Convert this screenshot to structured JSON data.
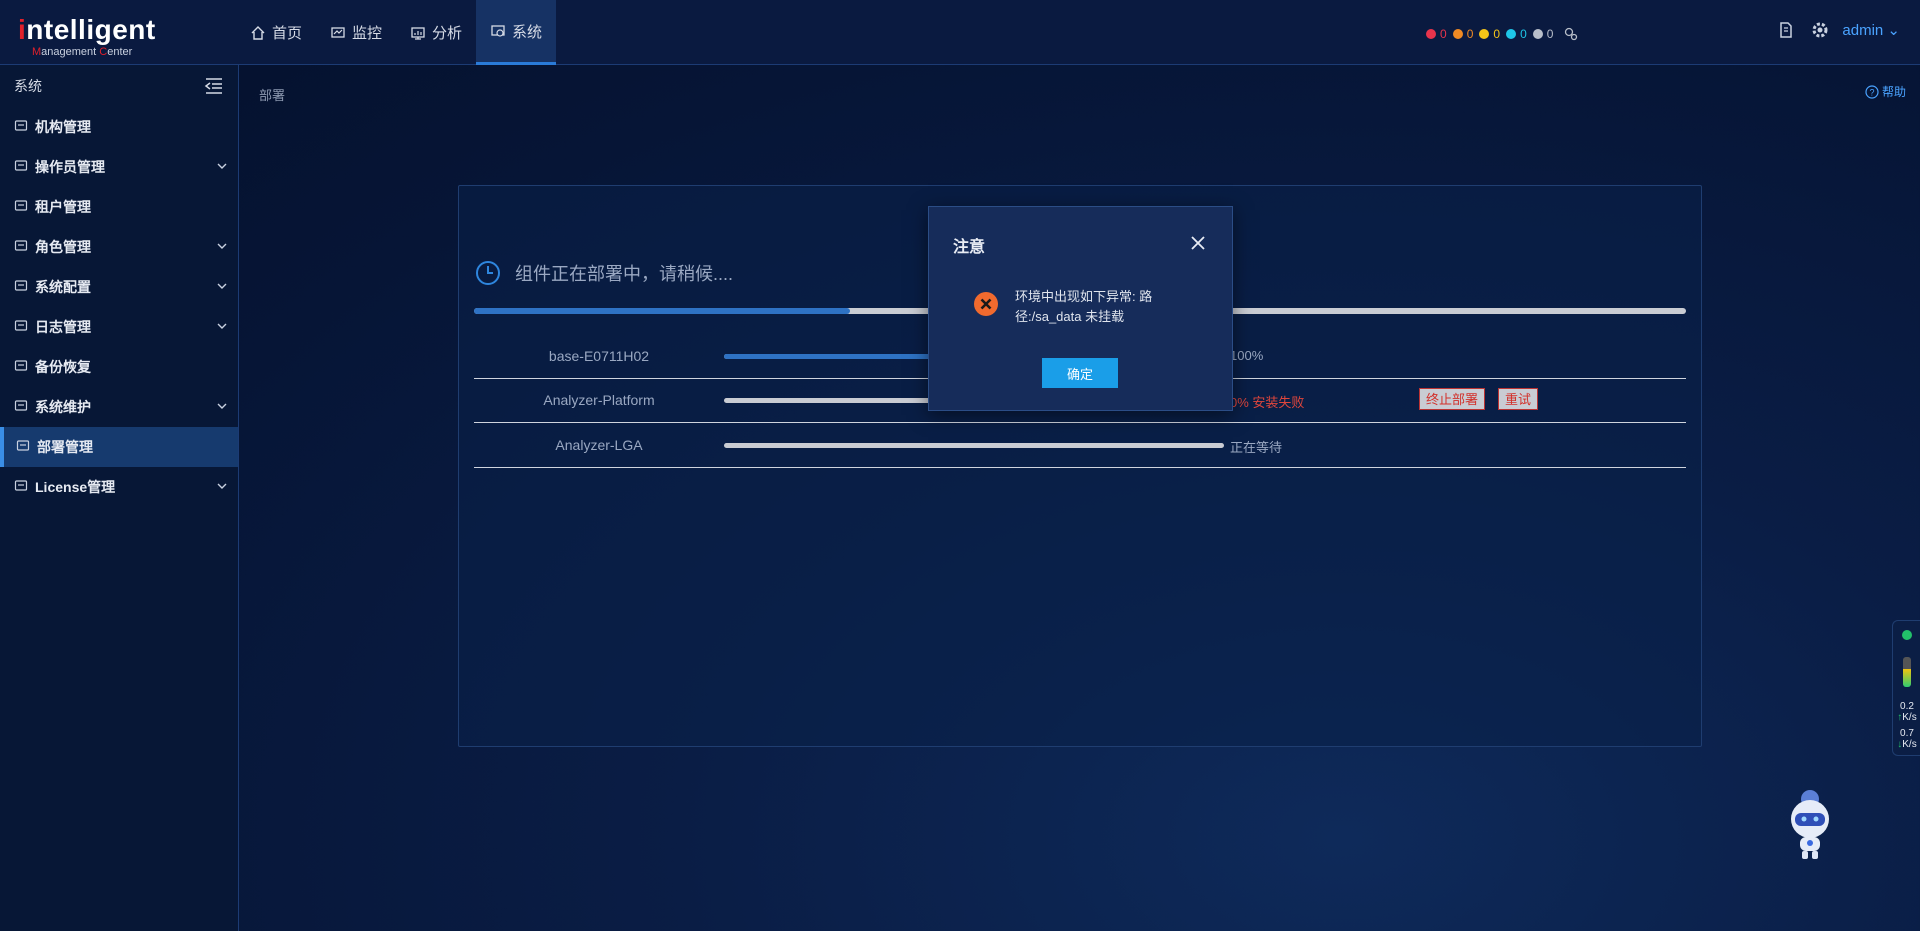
{
  "logo": {
    "main": "ntelligent",
    "main_prefix": "i",
    "sub_prefix": "M",
    "sub_rest": "anagement ",
    "sub_c": "C",
    "sub_end": "enter"
  },
  "nav": [
    {
      "label": "首页",
      "icon": "home-icon"
    },
    {
      "label": "监控",
      "icon": "monitor-icon"
    },
    {
      "label": "分析",
      "icon": "analysis-icon"
    },
    {
      "label": "系统",
      "icon": "system-icon",
      "active": true
    }
  ],
  "alarms": [
    {
      "count": "0",
      "color": "#e8344c"
    },
    {
      "count": "0",
      "color": "#f08a24"
    },
    {
      "count": "0",
      "color": "#f5c518"
    },
    {
      "count": "0",
      "color": "#1ec6e8"
    },
    {
      "count": "0",
      "color": "#b8bec9"
    }
  ],
  "user": {
    "name": "admin"
  },
  "sidebar": {
    "title": "系统",
    "items": [
      {
        "label": "机构管理",
        "icon": "org-icon",
        "has_children": false
      },
      {
        "label": "操作员管理",
        "icon": "operator-icon",
        "has_children": true
      },
      {
        "label": "租户管理",
        "icon": "tenant-icon",
        "has_children": false
      },
      {
        "label": "角色管理",
        "icon": "role-icon",
        "has_children": true
      },
      {
        "label": "系统配置",
        "icon": "config-icon",
        "has_children": true
      },
      {
        "label": "日志管理",
        "icon": "log-icon",
        "has_children": true
      },
      {
        "label": "备份恢复",
        "icon": "backup-icon",
        "has_children": false
      },
      {
        "label": "系统维护",
        "icon": "maintenance-icon",
        "has_children": true
      },
      {
        "label": "部署管理",
        "icon": "deploy-icon",
        "has_children": false,
        "active": true
      },
      {
        "label": "License管理",
        "icon": "license-icon",
        "has_children": true
      }
    ]
  },
  "breadcrumb": "部署",
  "help_label": "帮助",
  "deploy": {
    "title": "组件正在部署中，请稍候....",
    "overall_progress": 0.31,
    "rows": [
      {
        "name": "base-E0711H02",
        "progress": 1.0,
        "status": "100%",
        "status_type": "ok"
      },
      {
        "name": "Analyzer-Platform",
        "progress": 0.0,
        "status": "0% 安装失败",
        "status_type": "fail",
        "actions": [
          "终止部署",
          "重试"
        ]
      },
      {
        "name": "Analyzer-LGA",
        "progress": 0.0,
        "status": "正在等待",
        "status_type": "wait"
      }
    ]
  },
  "modal": {
    "title": "注意",
    "message": "环境中出现如下异常: 路径:/sa_data 未挂载",
    "ok_label": "确定"
  },
  "net_widget": {
    "up_value": "0.2",
    "up_unit": "K/s",
    "down_value": "0.7",
    "down_unit": "K/s"
  }
}
